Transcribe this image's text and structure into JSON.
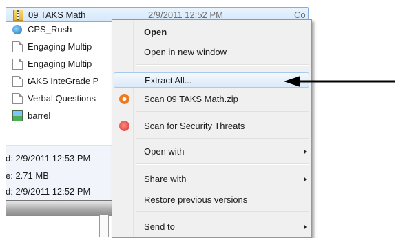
{
  "files": [
    {
      "name": "09 TAKS Math",
      "date": "2/9/2011 12:52 PM",
      "type": "Co",
      "icon": "zip-folder-icon",
      "selected": true
    },
    {
      "name": "CPS_Rush",
      "icon": "globe-icon"
    },
    {
      "name": "Engaging Multip",
      "icon": "document-icon"
    },
    {
      "name": "Engaging Multip",
      "icon": "document-icon"
    },
    {
      "name": "tAKS InteGrade P",
      "icon": "document-icon"
    },
    {
      "name": "Verbal Questions",
      "icon": "document-icon"
    },
    {
      "name": "barrel",
      "icon": "image-icon"
    }
  ],
  "details": {
    "line1": "d: 2/9/2011 12:53 PM",
    "line2": "e: 2.71 MB",
    "line3": "d: 2/9/2011 12:52 PM"
  },
  "context_menu": {
    "open": "Open",
    "open_new_window": "Open in new window",
    "extract_all": "Extract All...",
    "scan_zip": "Scan 09 TAKS Math.zip",
    "scan_security": "Scan for Security Threats",
    "open_with": "Open with",
    "share_with": "Share with",
    "restore_previous": "Restore previous versions",
    "send_to": "Send to"
  },
  "colors": {
    "selection": "#cce4f7",
    "menu_background": "#f0f0f0",
    "hover_border": "#a8c8ec"
  }
}
